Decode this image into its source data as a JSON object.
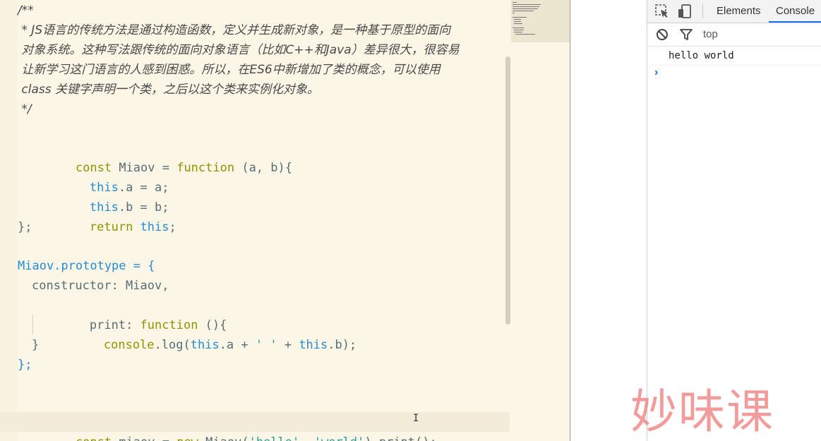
{
  "editor": {
    "comment": [
      "/**",
      " * JS语言的传统方法是通过构造函数，定义并生成新对象，是一种基于原型的面向",
      " 对象系统。这种写法跟传统的面向对象语言（比如C++和Java）差异很大，很容易",
      " 让新学习这门语言的人感到困惑。所以，在ES6中新增加了类的概念，可以使用",
      " class 关键字声明一个类，之后以这个类来实例化对象。",
      " */"
    ],
    "code": {
      "l1_const": "const",
      "l1_name": " Miaov = ",
      "l1_function": "function",
      "l1_params": " (a, b){",
      "l2_this": "this",
      "l2_rest": ".a = a;",
      "l3_this": "this",
      "l3_rest": ".b = b;",
      "l4_return": "return",
      "l4_this": "this",
      "l4_end": ";",
      "l5": "};",
      "l6_obj": "Miaov.prototype = {",
      "l7": "constructor: Miaov,",
      "l8_key": "print: ",
      "l8_function": "function",
      "l8_rest": " (){",
      "l9_console": "console",
      "l9_log": ".log(",
      "l9_this1": "this",
      "l9_a": ".a + ",
      "l9_str": "' '",
      "l9_plus": " + ",
      "l9_this2": "this",
      "l9_b": ".b);",
      "l10": "}",
      "l11": "};",
      "l12_const": "const",
      "l12_var": " miaov = ",
      "l12_new": "new",
      "l12_call": " Miaov(",
      "l12_str1": "'hello'",
      "l12_comma": ", ",
      "l12_str2": "'world'",
      "l12_end": ").print();"
    },
    "cursor_glyph": "I"
  },
  "devtools": {
    "tabs": [
      "Elements",
      "Console"
    ],
    "active_tab": "Console",
    "context": "top",
    "console_output": "hello world",
    "prompt": "›",
    "icons": [
      "inspect-element-icon",
      "device-toolbar-icon",
      "clear-console-icon",
      "filter-icon"
    ],
    "accent_color": "#1a73e8"
  },
  "watermark": "妙味课"
}
